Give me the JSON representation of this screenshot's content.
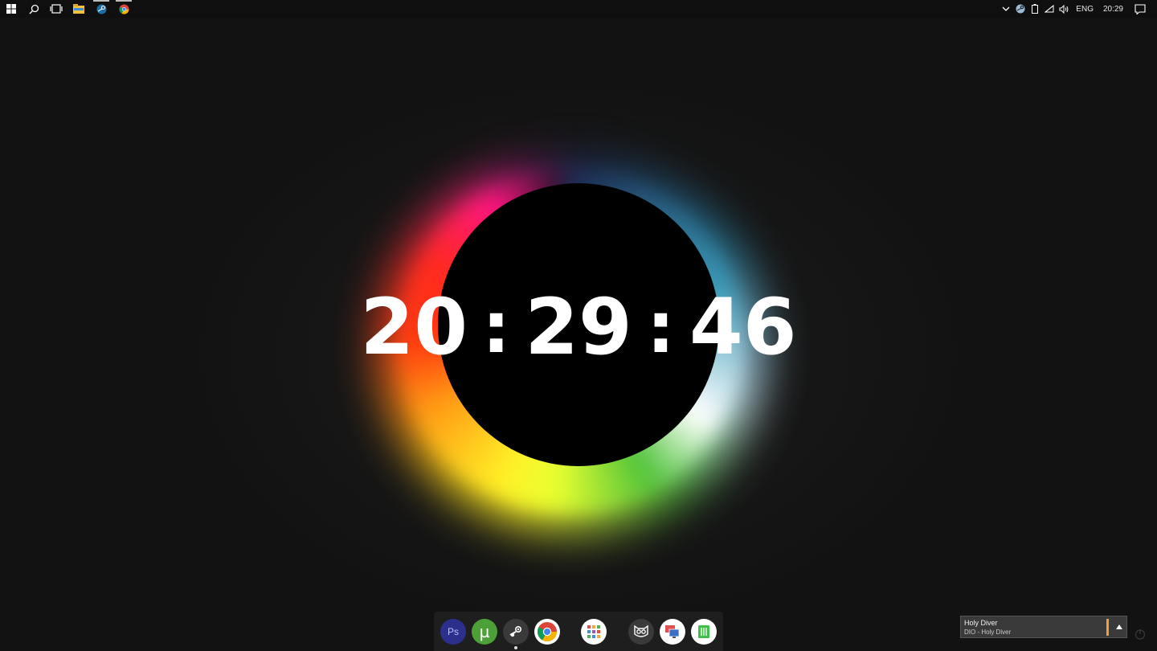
{
  "taskbar": {
    "left_icons": [
      "windows-start-icon",
      "search-icon",
      "task-view-icon",
      "file-explorer-icon",
      "steam-icon",
      "chrome-icon"
    ],
    "tray": {
      "icons": [
        "chevron-up-icon",
        "steam-tray-icon",
        "battery-icon",
        "wifi-icon",
        "volume-icon"
      ],
      "language": "ENG",
      "time": "20:29"
    }
  },
  "clock": {
    "hours": "20",
    "minutes": "29",
    "seconds": "46",
    "separator": ":"
  },
  "dock": {
    "apps": [
      {
        "name": "photoshop",
        "label": "Ps"
      },
      {
        "name": "utorrent",
        "label": "µ"
      },
      {
        "name": "steam",
        "label": ""
      },
      {
        "name": "chrome",
        "label": ""
      },
      {
        "name": "app-grid",
        "label": ""
      },
      {
        "name": "owl",
        "label": ""
      },
      {
        "name": "remote-desktop",
        "label": ""
      },
      {
        "name": "green-app",
        "label": ""
      }
    ]
  },
  "media": {
    "title": "Holy Diver",
    "subtitle": "DIO - Holy Diver"
  },
  "colors": {
    "background": "#121212",
    "accent": "#f0a040"
  }
}
